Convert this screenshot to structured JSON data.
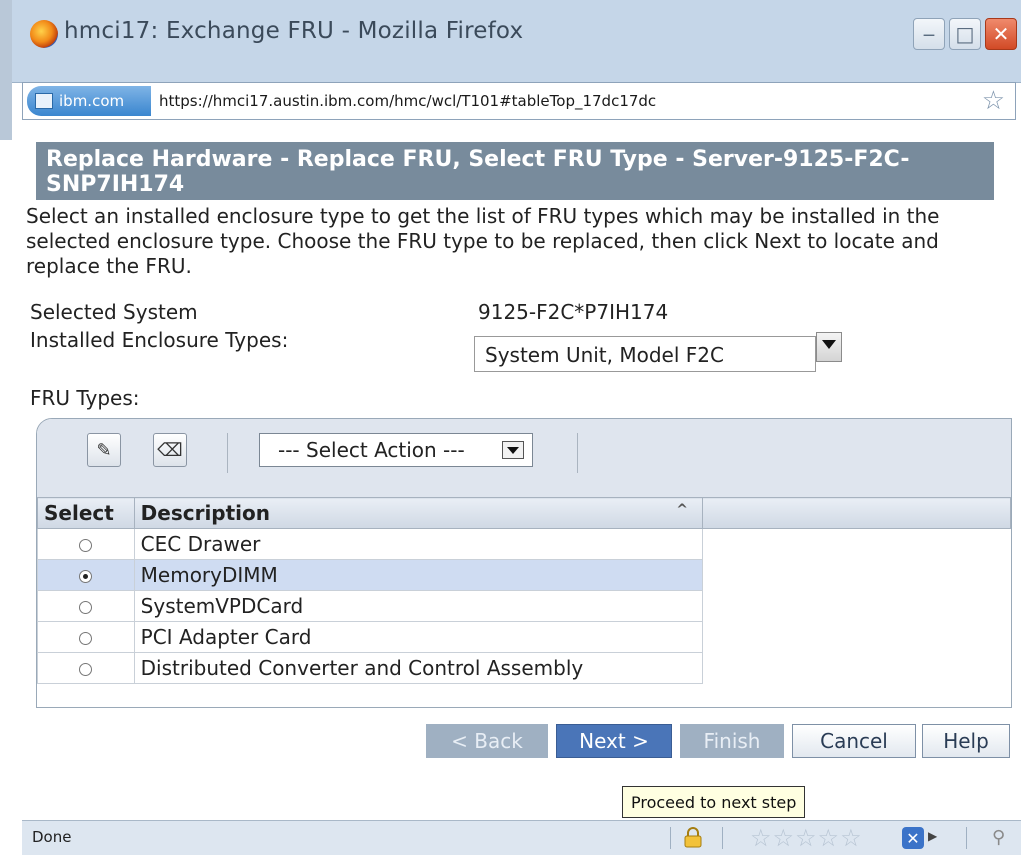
{
  "window": {
    "title": "hmci17: Exchange FRU - Mozilla Firefox",
    "min_icon": "minimize-icon",
    "max_icon": "maximize-icon",
    "close_icon": "close-icon"
  },
  "address_bar": {
    "site_label": "ibm.com",
    "url": "https://hmci17.austin.ibm.com/hmc/wcl/T101#tableTop_17dc17dc",
    "bookmark_icon": "star-icon"
  },
  "page": {
    "header": "Replace Hardware - Replace FRU, Select FRU Type - Server-9125-F2C-SNP7IH174",
    "intro": "Select an installed enclosure type to get the list of FRU types which may be installed in the selected enclosure type. Choose the FRU type to be replaced, then click Next to locate and replace the FRU.",
    "selected_system_label": "Selected System",
    "selected_system_value": "9125-F2C*P7IH174",
    "enclosure_label": "Installed Enclosure Types:",
    "enclosure_value": "System Unit, Model F2C",
    "fru_types_label": "FRU Types:"
  },
  "toolbar": {
    "select_all_icon": "select-all-icon",
    "deselect_all_icon": "deselect-all-icon",
    "action_select": "--- Select Action ---"
  },
  "table": {
    "columns": [
      "Select",
      "Description"
    ],
    "rows": [
      {
        "description": "CEC Drawer",
        "selected": false
      },
      {
        "description": "MemoryDIMM",
        "selected": true
      },
      {
        "description": "SystemVPDCard",
        "selected": false
      },
      {
        "description": "PCI Adapter Card",
        "selected": false
      },
      {
        "description": "Distributed Converter and Control Assembly",
        "selected": false
      }
    ]
  },
  "buttons": {
    "back": "< Back",
    "next": "Next >",
    "finish": "Finish",
    "cancel": "Cancel",
    "help": "Help"
  },
  "tooltip": "Proceed to next step",
  "status_bar": {
    "text": "Done"
  },
  "colors": {
    "header_bg": "#788b9c",
    "selected_row": "#cfdcf2",
    "primary_button": "#4a75b8",
    "disabled_button": "#9fb0c2"
  }
}
